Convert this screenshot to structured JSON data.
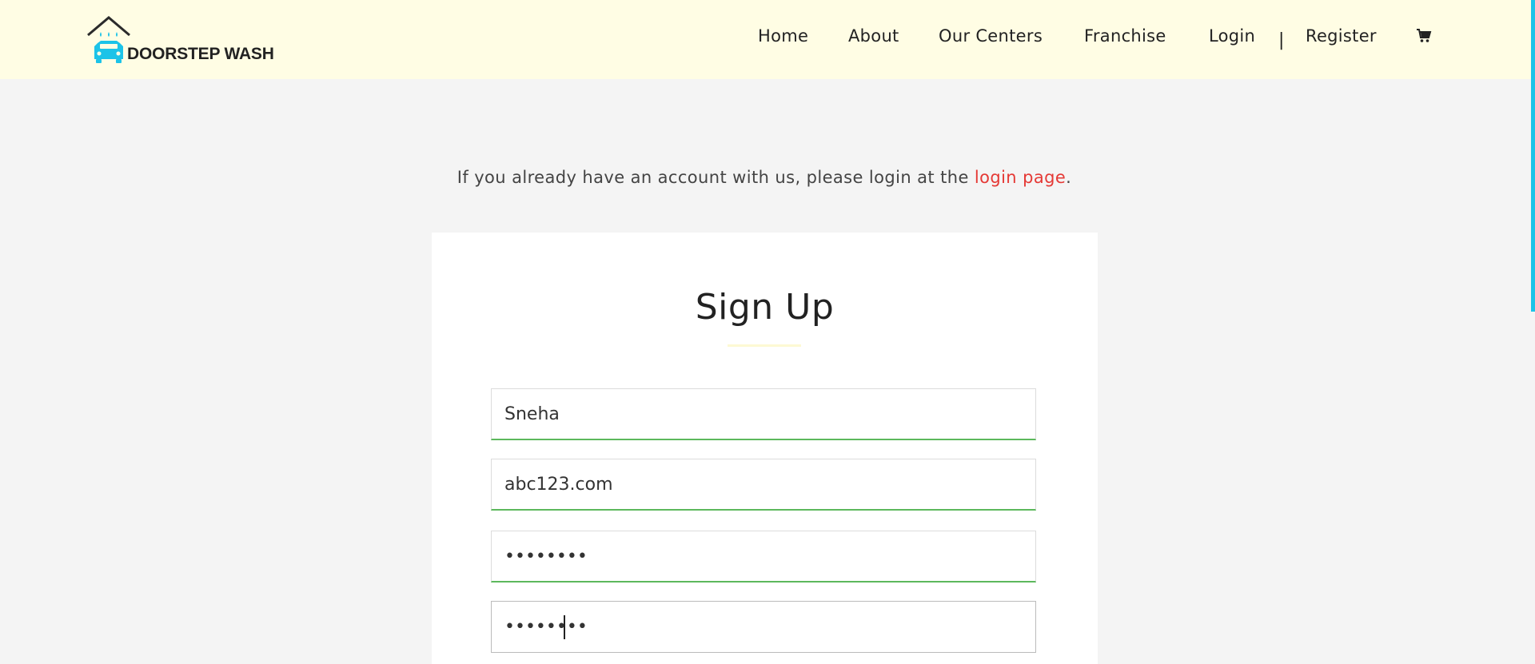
{
  "header": {
    "brand": "DOORSTEP WASH",
    "nav": [
      {
        "key": "home",
        "label": "Home"
      },
      {
        "key": "about",
        "label": "About"
      },
      {
        "key": "our-centers",
        "label": "Our Centers"
      },
      {
        "key": "franchise",
        "label": "Franchise"
      },
      {
        "key": "login",
        "label": "Login"
      },
      {
        "key": "register",
        "label": "Register"
      }
    ],
    "separator": "|",
    "cart_icon": "shopping-cart-icon"
  },
  "intro": {
    "text_before": "If you already have an account with us, please login at the ",
    "link_text": "login page",
    "text_after": "."
  },
  "form": {
    "title": "Sign Up",
    "fields": [
      {
        "name": "name",
        "value": "Sneha",
        "type": "text",
        "state": "valid"
      },
      {
        "name": "email",
        "value": "abc123.com",
        "type": "text",
        "state": "valid"
      },
      {
        "name": "password",
        "value": "xxxxxxxx",
        "type": "password",
        "state": "valid"
      },
      {
        "name": "confirm-password",
        "value": "xxxxxxxx",
        "type": "password",
        "state": "focused"
      }
    ]
  },
  "colors": {
    "header_bg": "#fffde4",
    "page_bg": "#f4f4f4",
    "link": "#e53935",
    "valid_border": "#5cb85c",
    "accent": "#1cc3e8"
  }
}
